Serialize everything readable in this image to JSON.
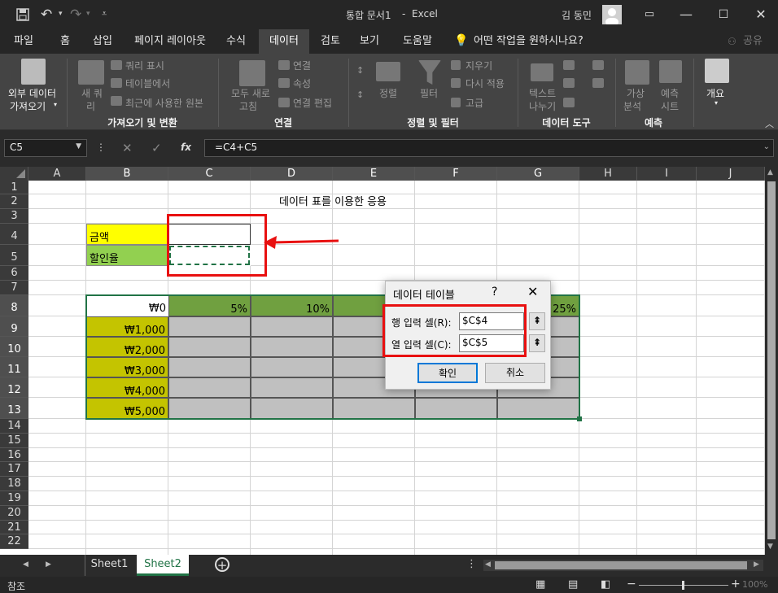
{
  "titlebar": {
    "title": "통합 문서1",
    "sep": "-",
    "app": "Excel",
    "user": "김 동민",
    "qat": {
      "save_icon": "save-icon",
      "undo_icon": "undo-icon",
      "redo_icon": "redo-icon"
    }
  },
  "menu": {
    "tabs": [
      "파일",
      "홈",
      "삽입",
      "페이지 레이아웃",
      "수식",
      "데이터",
      "검토",
      "보기",
      "도움말"
    ],
    "active": "데이터",
    "tellme": "어떤 작업을 원하시나요?",
    "share": "공유"
  },
  "ribbon": {
    "get_data": "외부 데이터\n가져오기",
    "get_data_1": "외부 데이터",
    "get_data_2": "가져오기",
    "new_query_1": "새 쿼",
    "new_query_2": "리",
    "query_show": "쿼리 표시",
    "from_table": "테이블에서",
    "recent_sources": "최근에 사용한 원본",
    "group_get": "가져오기 및 변환",
    "refresh_1": "모두 새로",
    "refresh_2": "고침",
    "connections": "연결",
    "properties": "속성",
    "edit_links": "연결 편집",
    "group_conn": "연결",
    "sort_btn": "정렬",
    "filter_btn": "필터",
    "clear": "지우기",
    "reapply": "다시 적용",
    "advanced": "고급",
    "group_sort": "정렬 및 필터",
    "text_to_col_1": "텍스트",
    "text_to_col_2": "나누기",
    "group_tools": "데이터 도구",
    "whatif_1": "가상",
    "whatif_2": "분석",
    "forecast_1": "예측",
    "forecast_2": "시트",
    "group_forecast": "예측",
    "outline": "개요"
  },
  "formula_bar": {
    "name_box": "C5",
    "formula": "=C4+C5",
    "fx": "fx"
  },
  "sheet": {
    "columns": [
      "A",
      "B",
      "C",
      "D",
      "E",
      "F",
      "G",
      "H",
      "I",
      "J"
    ],
    "rows": [
      "1",
      "2",
      "3",
      "4",
      "5",
      "6",
      "7",
      "8",
      "9",
      "10",
      "11",
      "12",
      "13",
      "14",
      "15",
      "16",
      "17",
      "18",
      "19",
      "20",
      "21",
      "22"
    ],
    "title_cell": "데이터 표를 이용한 응용",
    "label_amount": "금액",
    "label_discount": "할인율",
    "corner_value": "₩0",
    "rates": [
      "5%",
      "10%",
      "",
      "",
      "25%"
    ],
    "amounts": [
      "₩1,000",
      "₩2,000",
      "₩3,000",
      "₩4,000",
      "₩5,000"
    ]
  },
  "dialog": {
    "title": "데이터 테이블",
    "help": "?",
    "row_label": "행 입력 셀(R):",
    "row_value": "$C$4",
    "col_label": "열 입력 셀(C):",
    "col_value": "$C$5",
    "ok": "확인",
    "cancel": "취소"
  },
  "tabs": {
    "sheets": [
      "Sheet1",
      "Sheet2"
    ],
    "active": "Sheet2"
  },
  "status": {
    "mode": "참조",
    "zoom": "100%"
  },
  "colors": {
    "yellow": "#ffff00",
    "green_label": "#92d050",
    "olive_amount": "#c4c400",
    "olive_header": "#70a040",
    "gray_fill": "#c0c0c0",
    "annotation_red": "#e81010",
    "selection_green": "#217346"
  }
}
